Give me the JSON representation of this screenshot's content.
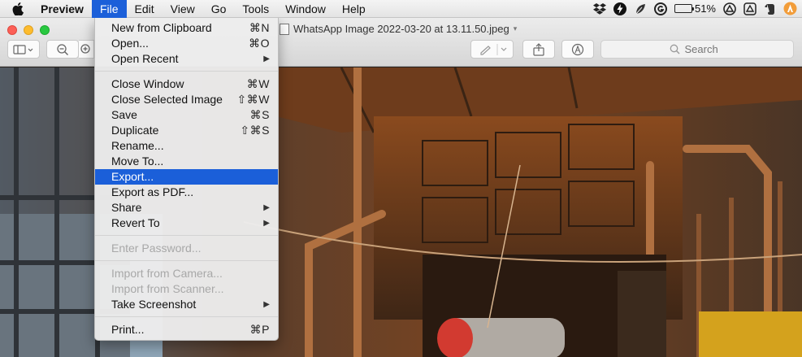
{
  "menubar": {
    "apple_icon": "apple-logo-icon",
    "app_name": "Preview",
    "items": [
      "File",
      "Edit",
      "View",
      "Go",
      "Tools",
      "Window",
      "Help"
    ],
    "active_item": "File",
    "status": {
      "icons": [
        "dropbox-icon",
        "bolt-icon",
        "leaf-icon",
        "grammarly-icon",
        "battery-icon",
        "airplay-icon",
        "drive-icon",
        "evernote-icon",
        "avast-icon"
      ],
      "battery_percent": "51%",
      "battery_level": 0.51
    }
  },
  "window": {
    "title": "WhatsApp Image 2022-03-20 at 13.11.50.jpeg",
    "search_placeholder": "Search",
    "toolbar_icons": [
      "sidebar-toggle-icon",
      "zoom-out-icon",
      "zoom-in-icon",
      "markup-pen-icon",
      "share-icon",
      "markup-toolbar-icon",
      "search-icon"
    ]
  },
  "file_menu": {
    "groups": [
      [
        {
          "label": "New from Clipboard",
          "shortcut": "⌘N"
        },
        {
          "label": "Open...",
          "shortcut": "⌘O"
        },
        {
          "label": "Open Recent",
          "submenu": true
        }
      ],
      [
        {
          "label": "Close Window",
          "shortcut": "⌘W"
        },
        {
          "label": "Close Selected Image",
          "shortcut": "⇧⌘W"
        },
        {
          "label": "Save",
          "shortcut": "⌘S"
        },
        {
          "label": "Duplicate",
          "shortcut": "⇧⌘S"
        },
        {
          "label": "Rename..."
        },
        {
          "label": "Move To..."
        },
        {
          "label": "Export...",
          "highlighted": true
        },
        {
          "label": "Export as PDF..."
        },
        {
          "label": "Share",
          "submenu": true
        },
        {
          "label": "Revert To",
          "submenu": true
        }
      ],
      [
        {
          "label": "Enter Password...",
          "disabled": true
        }
      ],
      [
        {
          "label": "Import from Camera...",
          "disabled": true
        },
        {
          "label": "Import from Scanner...",
          "disabled": true
        },
        {
          "label": "Take Screenshot",
          "submenu": true
        }
      ],
      [
        {
          "label": "Print...",
          "shortcut": "⌘P"
        }
      ]
    ]
  },
  "colors": {
    "menu_highlight": "#1b5fd9",
    "disabled_text": "#a8a8a8"
  }
}
